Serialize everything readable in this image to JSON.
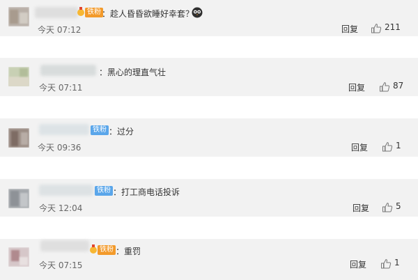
{
  "comments": [
    {
      "badge_label": "铁粉",
      "badge_color": "#f39a2a",
      "text": "：趁人昏昏欲睡好幸套？",
      "emoji_icon": "owl-face-icon",
      "time": "今天 07:12",
      "reply_label": "回复",
      "likes": "211"
    },
    {
      "text": "：黑心的理直气壮",
      "time": "今天 07:11",
      "reply_label": "回复",
      "likes": "87"
    },
    {
      "badge_label": "铁粉",
      "badge_color": "#5aa6ea",
      "text": "：过分",
      "time": "今天 09:36",
      "reply_label": "回复",
      "likes": "1"
    },
    {
      "badge_label": "铁粉",
      "badge_color": "#5aa6ea",
      "text": "：打工商电话投诉",
      "time": "今天 12:04",
      "reply_label": "回复",
      "likes": "5"
    },
    {
      "badge_label": "铁粉",
      "badge_color": "#f39a2a",
      "text": "：重罚",
      "time": "今天 07:15",
      "reply_label": "回复",
      "likes": "1"
    }
  ]
}
